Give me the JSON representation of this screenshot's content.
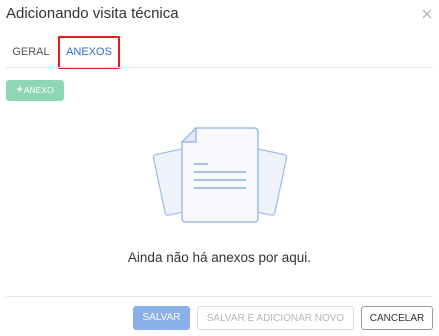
{
  "dialog": {
    "title": "Adicionando visita técnica",
    "close_icon": "close-icon"
  },
  "tabs": [
    {
      "label": "GERAL",
      "active": false
    },
    {
      "label": "ANEXOS",
      "active": true
    }
  ],
  "toolbar": {
    "add_label": "ANEXO",
    "add_icon": "plus-icon"
  },
  "empty_state": {
    "icon": "documents-icon",
    "message": "Ainda não há anexos por aqui."
  },
  "footer": {
    "save_label": "SALVAR",
    "save_new_label": "SALVAR E ADICIONAR NOVO",
    "cancel_label": "CANCELAR"
  },
  "colors": {
    "active_tab": "#2f6fce",
    "highlight": "#e31b1b",
    "add_button": "#8fd6b3",
    "save_button": "#8ab0ea"
  }
}
